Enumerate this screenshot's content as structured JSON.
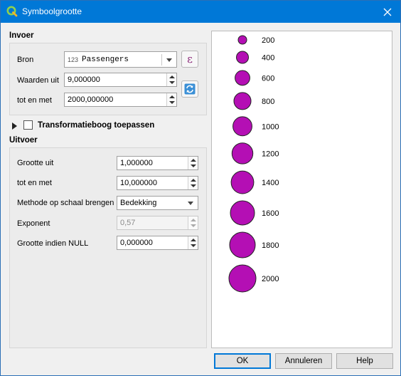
{
  "window": {
    "title": "Symboolgrootte"
  },
  "invoer": {
    "title": "Invoer",
    "bron": {
      "label": "Bron",
      "type_badge": "123",
      "value": "Passengers"
    },
    "waarden_uit": {
      "label": "Waarden uit",
      "value": "9,000000"
    },
    "tot_en_met": {
      "label": "tot en met",
      "value": "2000,000000"
    }
  },
  "transform": {
    "label": "Transformatieboog toepassen",
    "checked": false
  },
  "uitvoer": {
    "title": "Uitvoer",
    "grootte_uit": {
      "label": "Grootte uit",
      "value": "1,000000"
    },
    "tot_en_met": {
      "label": "tot en met",
      "value": "10,000000"
    },
    "methode": {
      "label": "Methode op schaal brengen",
      "value": "Bedekking"
    },
    "exponent": {
      "label": "Exponent",
      "value": "0,57"
    },
    "grootte_null": {
      "label": "Grootte indien NULL",
      "value": "0,000000"
    }
  },
  "legend": {
    "symbol_color": "#b40fb4",
    "stroke_color": "#222222",
    "items": [
      {
        "label": "200",
        "size": 200
      },
      {
        "label": "400",
        "size": 400
      },
      {
        "label": "600",
        "size": 600
      },
      {
        "label": "800",
        "size": 800
      },
      {
        "label": "1000",
        "size": 1000
      },
      {
        "label": "1200",
        "size": 1200
      },
      {
        "label": "1400",
        "size": 1400
      },
      {
        "label": "1600",
        "size": 1600
      },
      {
        "label": "1800",
        "size": 1800
      },
      {
        "label": "2000",
        "size": 2000
      }
    ]
  },
  "buttons": {
    "ok": "OK",
    "cancel": "Annuleren",
    "help": "Help"
  }
}
